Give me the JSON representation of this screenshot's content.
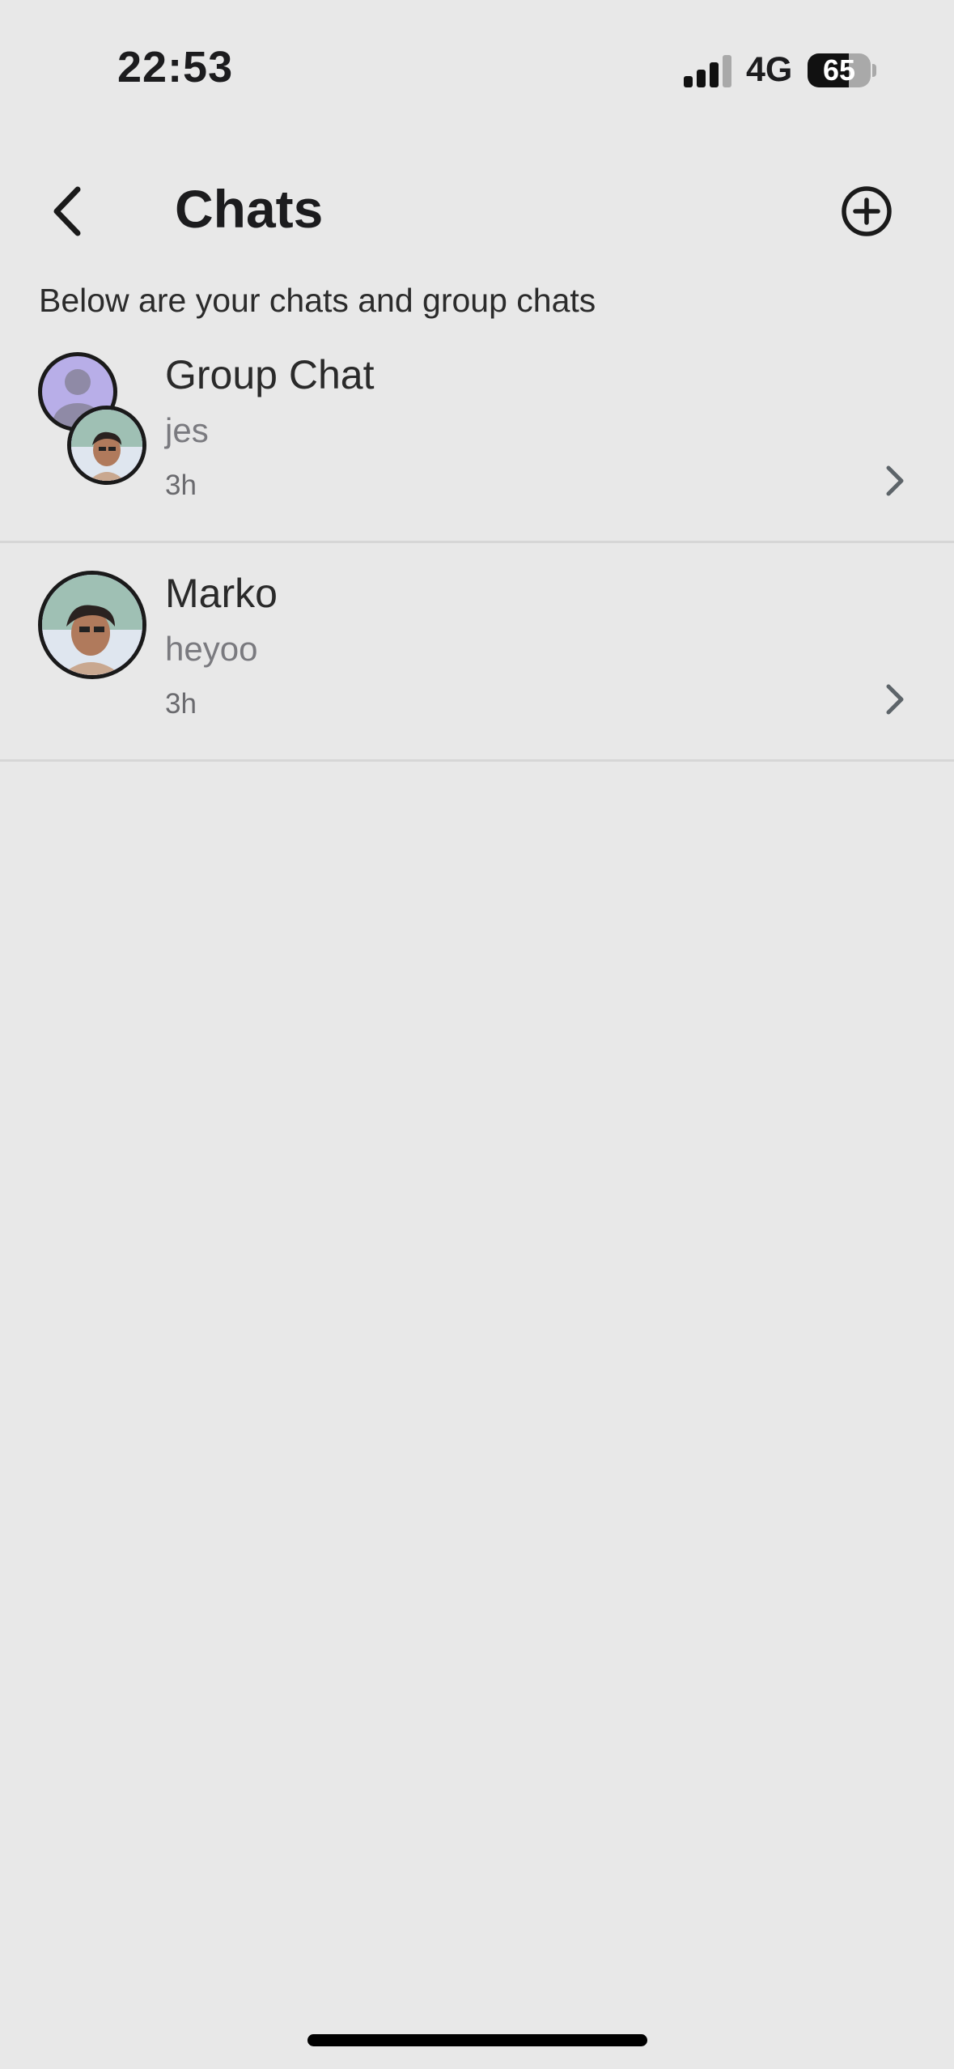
{
  "status_bar": {
    "time": "22:53",
    "network": "4G",
    "battery": "65"
  },
  "header": {
    "title": "Chats",
    "subtitle": "Below are your chats and group chats"
  },
  "chats": [
    {
      "name": "Group Chat",
      "last_message": "jes",
      "time": "3h"
    },
    {
      "name": "Marko",
      "last_message": "heyoo",
      "time": "3h"
    }
  ],
  "colors": {
    "background": "#e8e8e8",
    "avatar_background": "#b8aee8"
  }
}
